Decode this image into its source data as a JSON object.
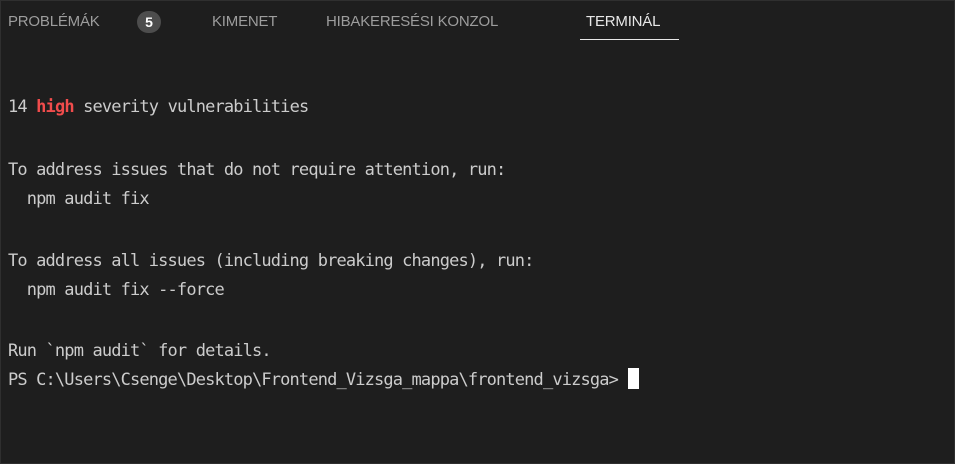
{
  "tabs": {
    "problems": {
      "label": "PROBLÉMÁK",
      "count": "5"
    },
    "output": {
      "label": "KIMENET"
    },
    "debug_console": {
      "label": "HIBAKERESÉSI KONZOL"
    },
    "terminal": {
      "label": "TERMINÁL",
      "active": true
    }
  },
  "terminal": {
    "vuln_count": "14",
    "vuln_severity": "high",
    "vuln_rest": " severity vulnerabilities",
    "fix_intro": "To address issues that do not require attention, run:",
    "fix_cmd": "  npm audit fix",
    "force_intro": "To address all issues (including breaking changes), run:",
    "force_cmd": "  npm audit fix --force",
    "details": "Run `npm audit` for details.",
    "prompt": "PS C:\\Users\\Csenge\\Desktop\\Frontend_Vizsga_mappa\\frontend_vizsga>"
  },
  "colors": {
    "background": "#1e1e1e",
    "text": "#cccccc",
    "high_severity": "#f14c4c",
    "tab_inactive": "#9d9d9d",
    "tab_active": "#e7e7e7"
  }
}
